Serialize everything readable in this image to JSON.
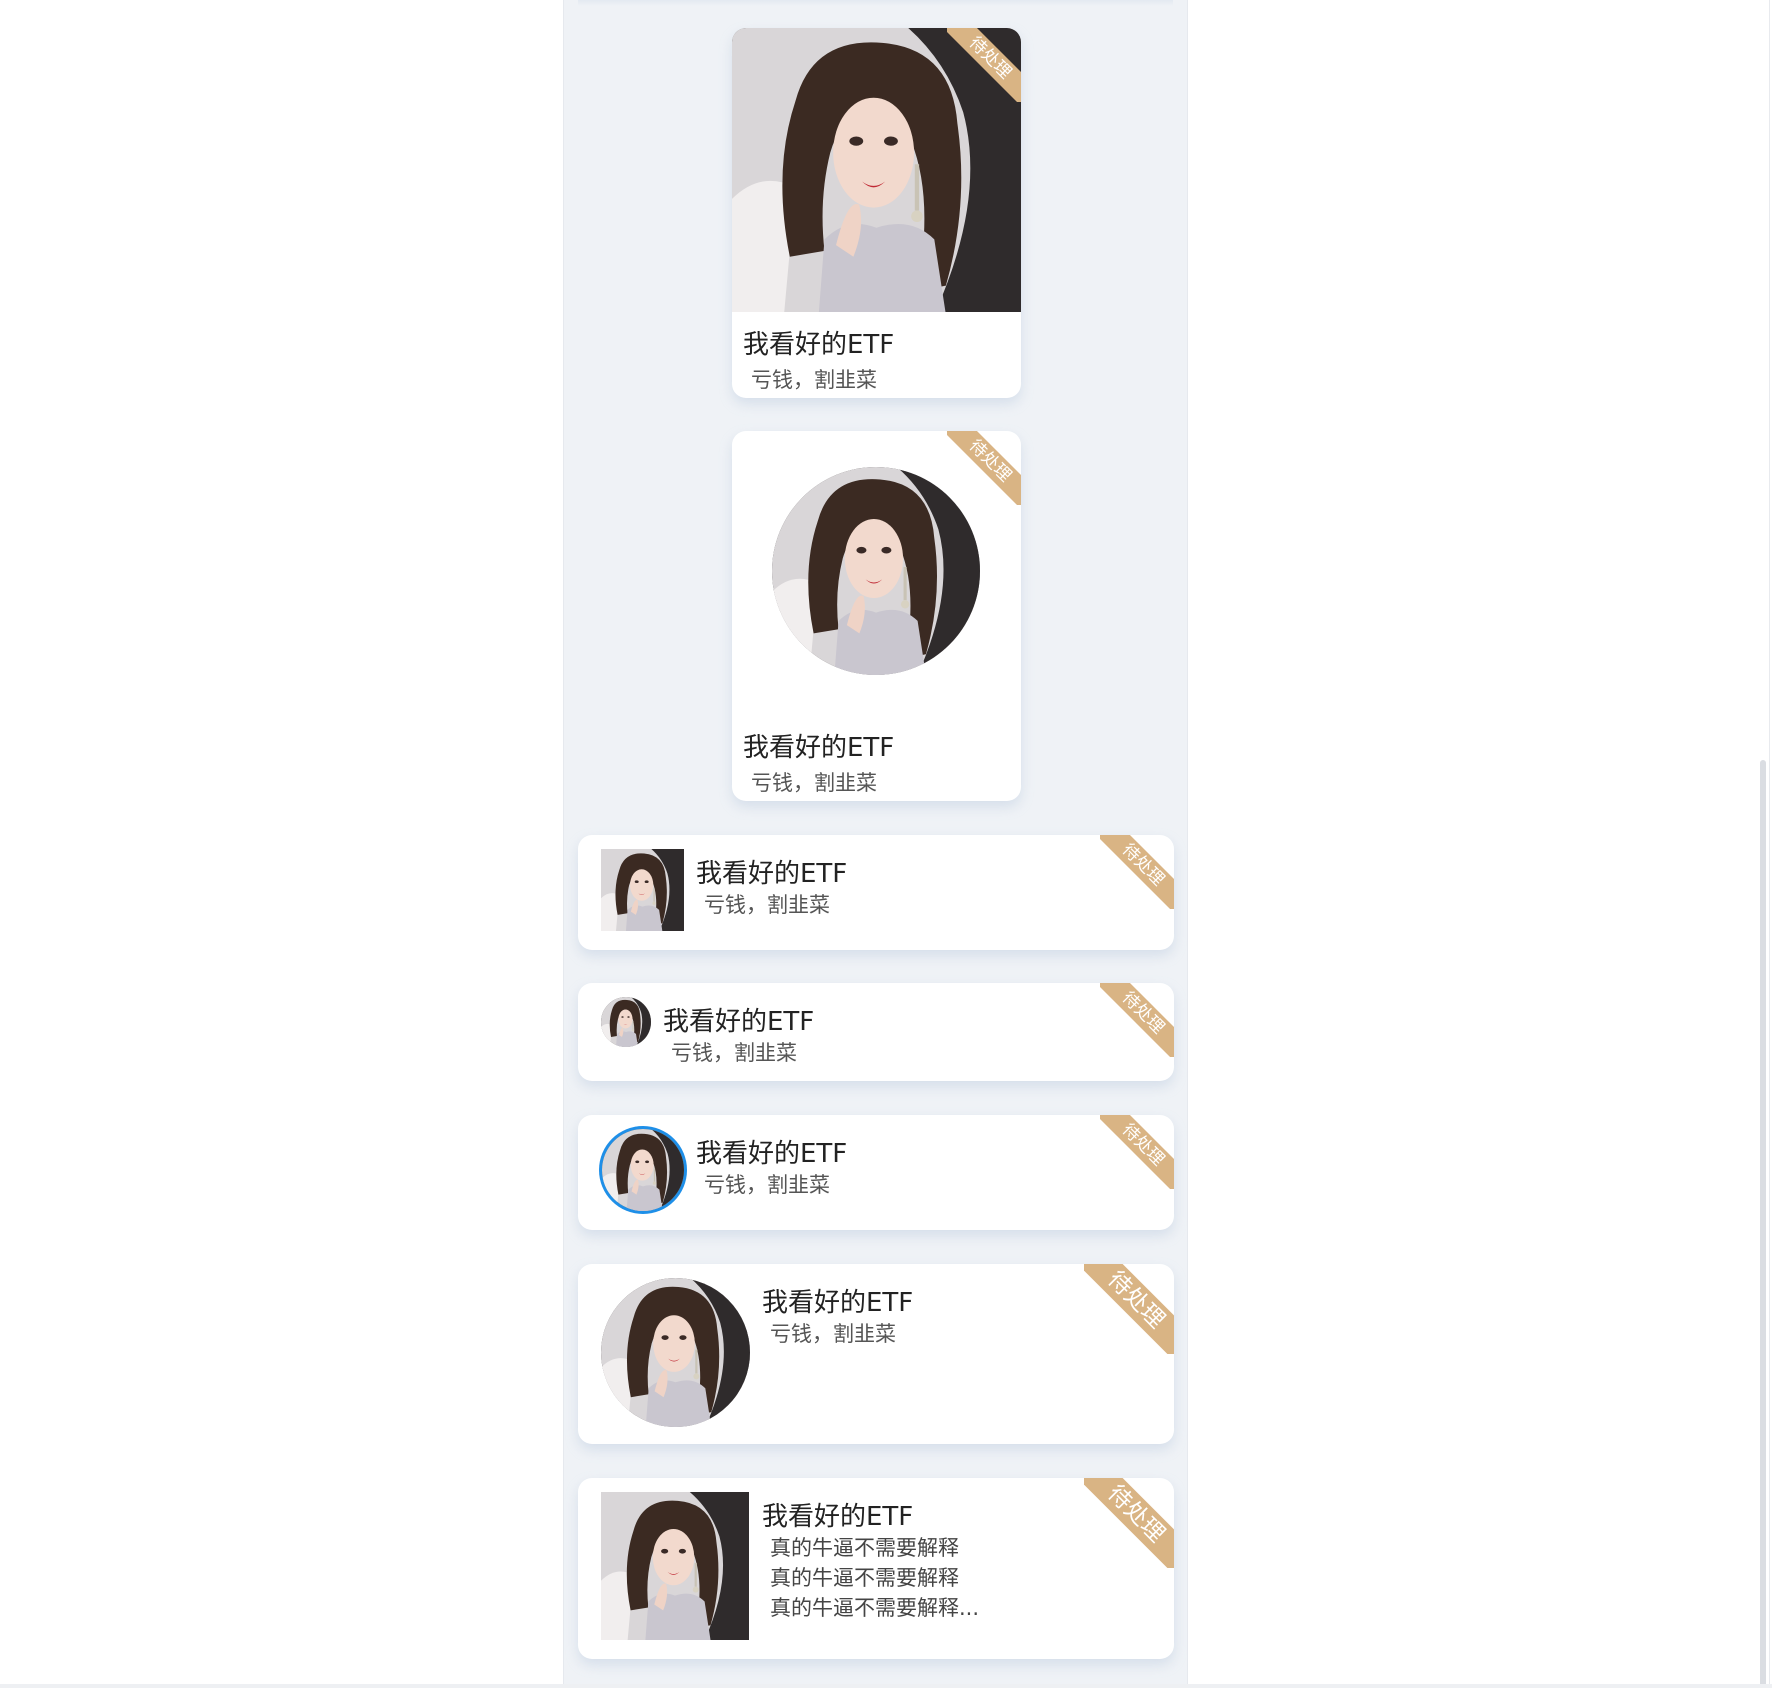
{
  "colors": {
    "strip_background": "#eff2f6",
    "card_background": "#ffffff",
    "ribbon": "#d9b484",
    "ring": "#1e8fe8",
    "title_text": "#222222",
    "subtitle_text": "#555555"
  },
  "avatar": {
    "icon": "portrait-photo",
    "alt": ""
  },
  "cards": [
    {
      "variant": "vertical-image",
      "badge": "待处理",
      "title": "我看好的ETF",
      "subtitle": "亏钱，割韭菜"
    },
    {
      "variant": "vertical-round-image",
      "badge": "待处理",
      "title": "我看好的ETF",
      "subtitle": "亏钱，割韭菜"
    },
    {
      "variant": "horizontal-square-thumb",
      "badge": "待处理",
      "title": "我看好的ETF",
      "subtitle": "亏钱，割韭菜"
    },
    {
      "variant": "horizontal-small-round-thumb",
      "badge": "待处理",
      "title": "我看好的ETF",
      "subtitle": "亏钱，割韭菜"
    },
    {
      "variant": "horizontal-ringed-round-thumb",
      "badge": "待处理",
      "title": "我看好的ETF",
      "subtitle": "亏钱，割韭菜"
    },
    {
      "variant": "horizontal-large-round-thumb",
      "badge": "待处理",
      "title": "我看好的ETF",
      "subtitle": "亏钱，割韭菜"
    },
    {
      "variant": "horizontal-large-square-thumb",
      "badge": "待处理",
      "title": "我看好的ETF",
      "description_lines": [
        "真的牛逼不需要解释",
        "真的牛逼不需要解释",
        "真的牛逼不需要解释..."
      ]
    }
  ]
}
